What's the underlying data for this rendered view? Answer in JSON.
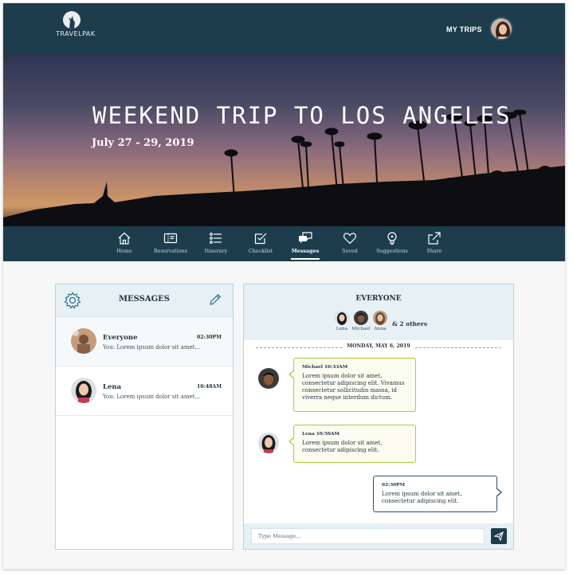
{
  "header": {
    "logo_text": "TRAVELPAK",
    "my_trips_label": "MY TRIPS"
  },
  "hero": {
    "title": "WEEKEND TRIP TO LOS ANGELES",
    "dates": "July 27 - 29, 2019"
  },
  "tabs": [
    {
      "label": "Home",
      "icon": "home-icon"
    },
    {
      "label": "Reservations",
      "icon": "ticket-icon"
    },
    {
      "label": "Itinerary",
      "icon": "list-icon"
    },
    {
      "label": "Checklist",
      "icon": "checklist-icon"
    },
    {
      "label": "Messages",
      "icon": "chat-icon",
      "active": true
    },
    {
      "label": "Saved",
      "icon": "heart-icon"
    },
    {
      "label": "Suggestions",
      "icon": "lightbulb-icon"
    },
    {
      "label": "Share",
      "icon": "share-icon"
    }
  ],
  "messages_panel": {
    "title": "MESSAGES",
    "conversations": [
      {
        "name": "Everyone",
        "time": "02:30PM",
        "preview": "You: Lorem ipsum dolor sit amet..."
      },
      {
        "name": "Lena",
        "time": "10:48AM",
        "preview": "You: Lorem ipsum dolor sit amet..."
      }
    ]
  },
  "chat": {
    "title": "EVERYONE",
    "members": [
      "Lena",
      "Michael",
      "Anna"
    ],
    "others_label": "& 2 others",
    "date_divider": "MONDAY, MAY 6, 2019",
    "messages": [
      {
        "meta": "Michael 10:33AM",
        "text": "Lorem ipsum dolor sit amet, consectetur adipiscing elit. Vivamus consectetur sollicitudin massa, id viverra neque interdum dictum."
      },
      {
        "meta": "Lena 10:50AM",
        "text": "Lorem ipsum dolor sit amet, consectetur adipiscing elit."
      },
      {
        "meta": "02:30PM",
        "text": "Lorem ipsum dolor sit amet, consectetur adipiscing elit."
      }
    ],
    "input_placeholder": "Type Message..."
  },
  "colors": {
    "navy": "#1d3d4d",
    "light_blue": "#e6f0f5",
    "bubble_border": "#a8cc3a"
  }
}
